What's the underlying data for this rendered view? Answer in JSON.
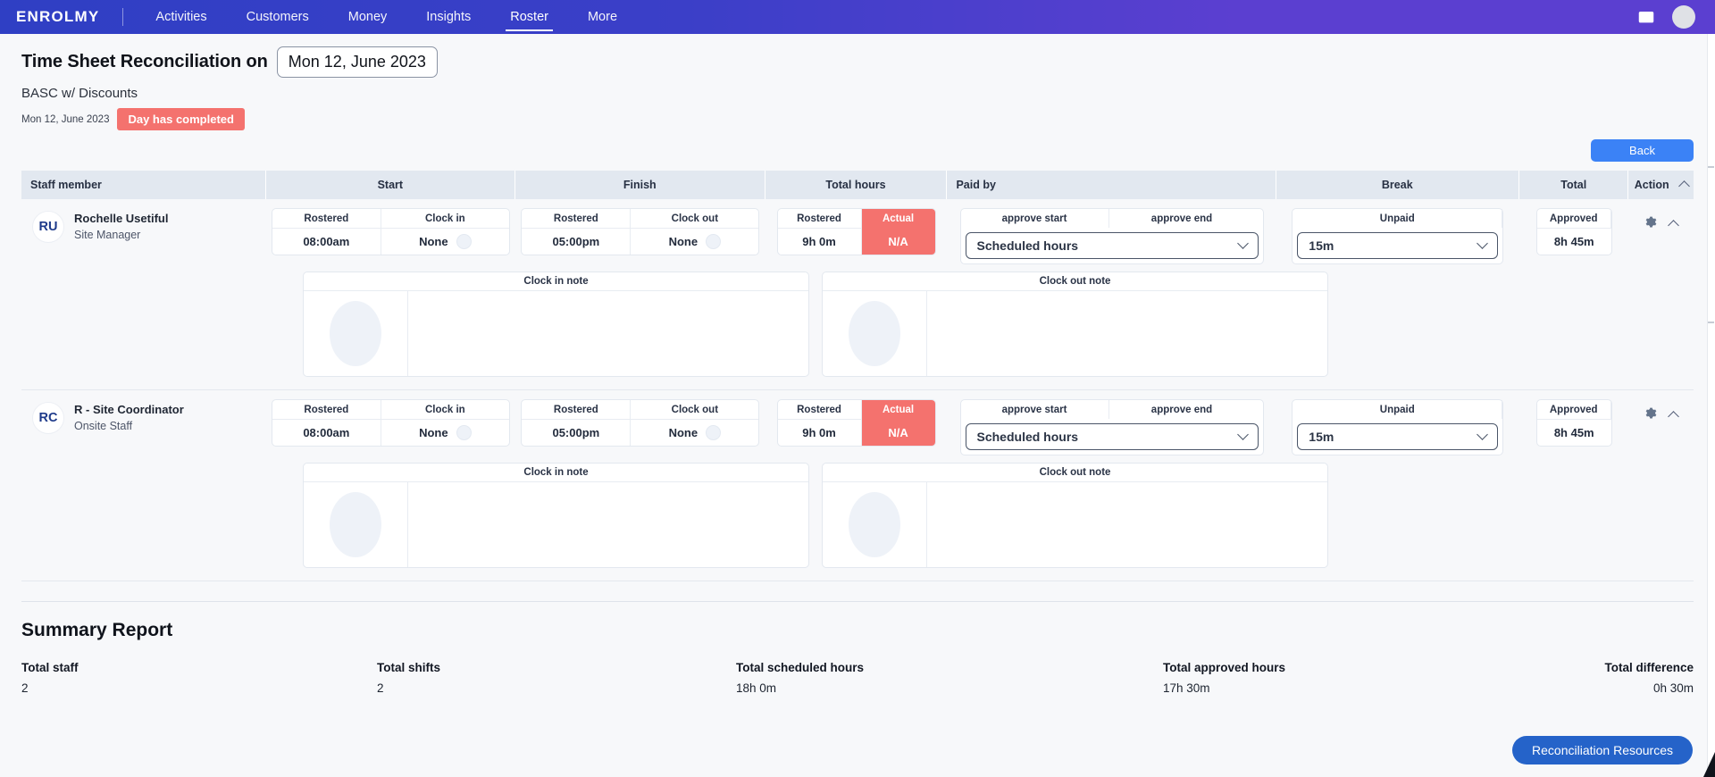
{
  "nav": {
    "brand": "ENROLMY",
    "items": [
      {
        "label": "Activities",
        "active": false
      },
      {
        "label": "Customers",
        "active": false
      },
      {
        "label": "Money",
        "active": false
      },
      {
        "label": "Insights",
        "active": false
      },
      {
        "label": "Roster",
        "active": true
      },
      {
        "label": "More",
        "active": false
      }
    ],
    "inbox_icon": "inbox-icon",
    "avatar_icon": "user-avatar"
  },
  "header": {
    "title": "Time Sheet Reconciliation on",
    "date_value": "Mon 12, June 2023",
    "organisation": "BASC w/ Discounts",
    "meta_date": "Mon 12, June 2023",
    "status_badge": "Day has completed",
    "back_label": "Back"
  },
  "table": {
    "columns": [
      "Staff member",
      "Start",
      "Finish",
      "Total hours",
      "Paid by",
      "Break",
      "Total",
      "Action"
    ],
    "sort_icon": "chevron-up-icon",
    "rows": [
      {
        "initials": "RU",
        "name": "Rochelle Usetiful",
        "role": "Site Manager",
        "start": {
          "head_a": "Rostered",
          "head_b": "Clock in",
          "val_a": "08:00am",
          "val_b": "None"
        },
        "finish": {
          "head_a": "Rostered",
          "head_b": "Clock out",
          "val_a": "05:00pm",
          "val_b": "None"
        },
        "total_hours": {
          "head_a": "Rostered",
          "head_b": "Actual",
          "val_a": "9h 0m",
          "val_b": "N/A"
        },
        "paid_by": {
          "head_a": "approve start",
          "head_b": "approve end",
          "selected": "Scheduled hours"
        },
        "break": {
          "head": "Unpaid",
          "selected": "15m"
        },
        "total": {
          "head": "Approved",
          "val": "8h 45m"
        },
        "clock_in_note": "Clock in note",
        "clock_out_note": "Clock out note",
        "settings_icon": "gear-icon",
        "collapse_icon": "chevron-up-icon"
      },
      {
        "initials": "RC",
        "name": "R - Site Coordinator",
        "role": "Onsite Staff",
        "start": {
          "head_a": "Rostered",
          "head_b": "Clock in",
          "val_a": "08:00am",
          "val_b": "None"
        },
        "finish": {
          "head_a": "Rostered",
          "head_b": "Clock out",
          "val_a": "05:00pm",
          "val_b": "None"
        },
        "total_hours": {
          "head_a": "Rostered",
          "head_b": "Actual",
          "val_a": "9h 0m",
          "val_b": "N/A"
        },
        "paid_by": {
          "head_a": "approve start",
          "head_b": "approve end",
          "selected": "Scheduled hours"
        },
        "break": {
          "head": "Unpaid",
          "selected": "15m"
        },
        "total": {
          "head": "Approved",
          "val": "8h 45m"
        },
        "clock_in_note": "Clock in note",
        "clock_out_note": "Clock out note",
        "settings_icon": "gear-icon",
        "collapse_icon": "chevron-up-icon"
      }
    ]
  },
  "summary": {
    "title": "Summary Report",
    "stats": [
      {
        "label": "Total staff",
        "value": "2"
      },
      {
        "label": "Total shifts",
        "value": "2"
      },
      {
        "label": "Total scheduled hours",
        "value": "18h 0m"
      },
      {
        "label": "Total approved hours",
        "value": "17h 30m"
      },
      {
        "label": "Total difference",
        "value": "0h 30m"
      }
    ]
  },
  "footer": {
    "reconciliation_button": "Reconciliation Resources"
  },
  "colors": {
    "nav_gradient_start": "#2f3fc4",
    "nav_gradient_end": "#5b3fd0",
    "danger": "#f4726e",
    "primary_button": "#3b82f6",
    "accent_button": "#2563c9",
    "page_bg": "#f7f8fa",
    "table_header_bg": "#e2e8f0"
  }
}
